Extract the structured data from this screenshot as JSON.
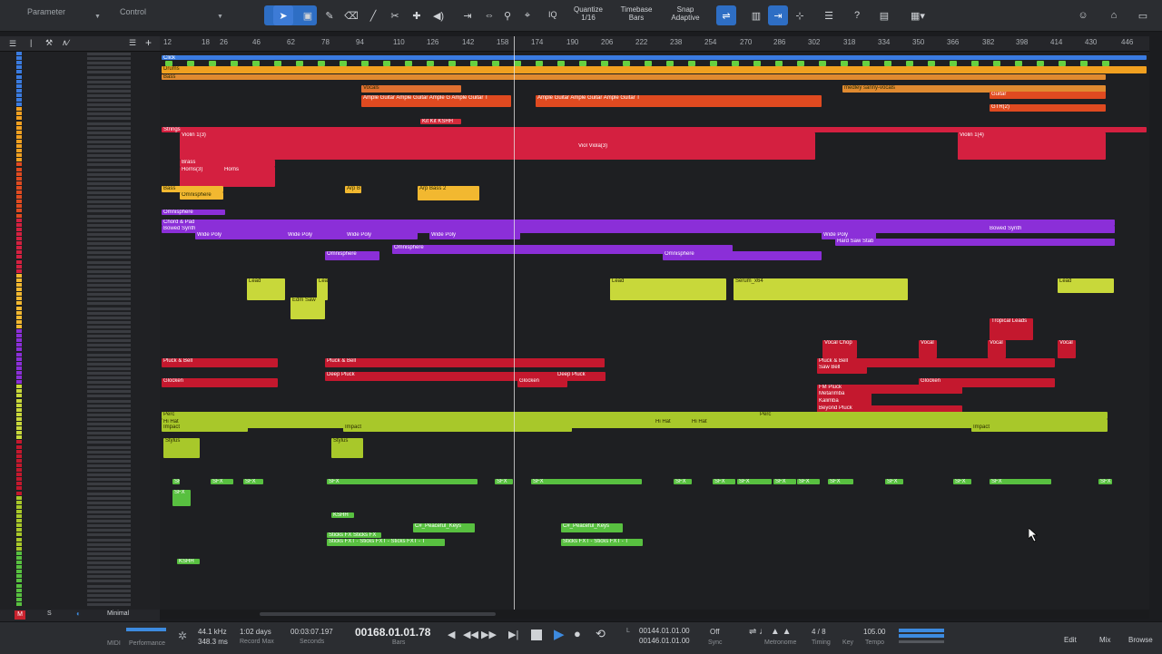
{
  "toolbar": {
    "parameter_label": "Parameter",
    "control_label": "Control",
    "quantize_label": "Quantize",
    "quantize_value": "1/16",
    "timebase_label": "Timebase",
    "timebase_value": "Bars",
    "snap_label": "Snap",
    "snap_value": "Adaptive",
    "iq_label": "IQ"
  },
  "ruler": {
    "ticks": [
      "12",
      "18",
      "26",
      "46",
      "62",
      "78",
      "94",
      "110",
      "126",
      "142",
      "158",
      "174",
      "190",
      "206",
      "222",
      "238",
      "254",
      "270",
      "286",
      "302",
      "318",
      "334",
      "350",
      "366",
      "382",
      "398",
      "414",
      "430",
      "446"
    ]
  },
  "clips": [
    {
      "label": "Click",
      "color": "#3a7be0",
      "light": false
    },
    {
      "label": "Drums",
      "color": "#f0a020",
      "light": true
    },
    {
      "label": "Bass",
      "color": "#e08a30",
      "light": true
    },
    {
      "label": "Vocals",
      "color": "#e07030",
      "light": true
    },
    {
      "label": "medley sanny-vocals",
      "color": "#e08a30",
      "light": true
    },
    {
      "label": "Guitar",
      "color": "#e04a20",
      "light": false
    },
    {
      "label": "Ample Guitar Ample Guitar Ample G Ample Guitar T",
      "color": "#e04a20",
      "light": false
    },
    {
      "label": "Ample Guitar Ample Guitar Ample Guitar T",
      "color": "#e04a20",
      "light": false
    },
    {
      "label": "GTR(2)",
      "color": "#e04a20",
      "light": false
    },
    {
      "label": "Kit Kit KSHH",
      "color": "#d42a3a",
      "light": false
    },
    {
      "label": "Strings",
      "color": "#d42040",
      "light": false
    },
    {
      "label": "Violin 1(3)",
      "color": "#d42040",
      "light": false
    },
    {
      "label": "Viol Viola(3)",
      "color": "#d42040",
      "light": false
    },
    {
      "label": "Violin 1(4)",
      "color": "#d42040",
      "light": false
    },
    {
      "label": "Brass",
      "color": "#d42040",
      "light": false
    },
    {
      "label": "Horns(3)",
      "color": "#d42040",
      "light": false
    },
    {
      "label": "Horns",
      "color": "#d42040",
      "light": false
    },
    {
      "label": "Bass",
      "color": "#f2b830",
      "light": true
    },
    {
      "label": "Omnisphere",
      "color": "#f2b830",
      "light": true
    },
    {
      "label": "Arp B",
      "color": "#f2b830",
      "light": true
    },
    {
      "label": "Arp Bass 2",
      "color": "#f2b830",
      "light": true
    },
    {
      "label": "Chord & Pad",
      "color": "#8b2fd8",
      "light": false
    },
    {
      "label": "Bowed Synth",
      "color": "#8b2fd8",
      "light": false
    },
    {
      "label": "Wide Poly",
      "color": "#8b2fd8",
      "light": false
    },
    {
      "label": "Wide Poly",
      "color": "#8b2fd8",
      "light": false
    },
    {
      "label": "Wide Poly",
      "color": "#8b2fd8",
      "light": false
    },
    {
      "label": "Wide Poly",
      "color": "#8b2fd8",
      "light": false
    },
    {
      "label": "Bowed Synth",
      "color": "#8b2fd8",
      "light": false
    },
    {
      "label": "Wide Poly",
      "color": "#8b2fd8",
      "light": false
    },
    {
      "label": "Hard Saw Stab",
      "color": "#8b2fd8",
      "light": false
    },
    {
      "label": "Omnisphere",
      "color": "#8b2fd8",
      "light": false
    },
    {
      "label": "Omnisphere",
      "color": "#8b2fd8",
      "light": false
    },
    {
      "label": "Omnisphere",
      "color": "#8b2fd8",
      "light": false
    },
    {
      "label": "Omnisphere",
      "color": "#8b2fd8",
      "light": false
    },
    {
      "label": "Lead",
      "color": "#c8d83a",
      "light": true
    },
    {
      "label": "Lead",
      "color": "#c8d83a",
      "light": true
    },
    {
      "label": "Edm Saw",
      "color": "#c8d83a",
      "light": true
    },
    {
      "label": "Lead",
      "color": "#c8d83a",
      "light": true
    },
    {
      "label": "Serum_x64",
      "color": "#c8d83a",
      "light": true
    },
    {
      "label": "Lead",
      "color": "#c8d83a",
      "light": true
    },
    {
      "label": "Tropical Leads",
      "color": "#c4182e",
      "light": false
    },
    {
      "label": "Vocal Chop",
      "color": "#c4182e",
      "light": false
    },
    {
      "label": "Vocal",
      "color": "#c4182e",
      "light": false
    },
    {
      "label": "Vocal",
      "color": "#c4182e",
      "light": false
    },
    {
      "label": "Vocal",
      "color": "#c4182e",
      "light": false
    },
    {
      "label": "Pluck & Bell",
      "color": "#c4182e",
      "light": false
    },
    {
      "label": "Pluck & Bell",
      "color": "#c4182e",
      "light": false
    },
    {
      "label": "Deep Pluck",
      "color": "#c4182e",
      "light": false
    },
    {
      "label": "Deep Pluck",
      "color": "#c4182e",
      "light": false
    },
    {
      "label": "Pluck & Bell",
      "color": "#c4182e",
      "light": false
    },
    {
      "label": "Saw Bell",
      "color": "#c4182e",
      "light": false
    },
    {
      "label": "Glocken",
      "color": "#c4182e",
      "light": false
    },
    {
      "label": "Glocken",
      "color": "#c4182e",
      "light": false
    },
    {
      "label": "Glocken",
      "color": "#c4182e",
      "light": false
    },
    {
      "label": "Serum_x64",
      "color": "#c4182e",
      "light": false
    },
    {
      "label": "FM Pluck",
      "color": "#c4182e",
      "light": false
    },
    {
      "label": "Metarimba",
      "color": "#c4182e",
      "light": false
    },
    {
      "label": "Kalimba",
      "color": "#c4182e",
      "light": false
    },
    {
      "label": "Beyond Pluck",
      "color": "#c4182e",
      "light": false
    },
    {
      "label": "Perc",
      "color": "#a8c82a",
      "light": true
    },
    {
      "label": "Hi Hat",
      "color": "#a8c82a",
      "light": true
    },
    {
      "label": "Impact",
      "color": "#a8c82a",
      "light": true
    },
    {
      "label": "Hi Hat",
      "color": "#a8c82a",
      "light": true
    },
    {
      "label": "Hi Hat",
      "color": "#a8c82a",
      "light": true
    },
    {
      "label": "Perc",
      "color": "#a8c82a",
      "light": true
    },
    {
      "label": "Impact",
      "color": "#a8c82a",
      "light": true
    },
    {
      "label": "Impact",
      "color": "#a8c82a",
      "light": true
    },
    {
      "label": "Stylus",
      "color": "#a8c82a",
      "light": true
    },
    {
      "label": "Stylus",
      "color": "#a8c82a",
      "light": true
    },
    {
      "label": "SFX",
      "color": "#58c040",
      "light": false
    },
    {
      "label": "SFX",
      "color": "#58c040",
      "light": false
    },
    {
      "label": "SFX",
      "color": "#58c040",
      "light": false
    },
    {
      "label": "SFX",
      "color": "#58c040",
      "light": false
    },
    {
      "label": "SFX",
      "color": "#58c040",
      "light": false
    },
    {
      "label": "SFX",
      "color": "#58c040",
      "light": false
    },
    {
      "label": "SFX",
      "color": "#58c040",
      "light": false
    },
    {
      "label": "SFX",
      "color": "#58c040",
      "light": false
    },
    {
      "label": "SFX",
      "color": "#58c040",
      "light": false
    },
    {
      "label": "SFX",
      "color": "#58c040",
      "light": false
    },
    {
      "label": "SFX",
      "color": "#58c040",
      "light": false
    },
    {
      "label": "SFX",
      "color": "#58c040",
      "light": false
    },
    {
      "label": "SFX",
      "color": "#58c040",
      "light": false
    },
    {
      "label": "SFX",
      "color": "#58c040",
      "light": false
    },
    {
      "label": "SFX",
      "color": "#58c040",
      "light": false
    },
    {
      "label": "SFX",
      "color": "#58c040",
      "light": false
    },
    {
      "label": "SFX",
      "color": "#58c040",
      "light": false
    },
    {
      "label": "Sticks FX Sticks FX",
      "color": "#58c040",
      "light": false
    },
    {
      "label": "Sticks FXT - Sticks FXT - Sticks FXT - T",
      "color": "#58c040",
      "light": false
    },
    {
      "label": "Sticks FXT - Sticks FXT - T",
      "color": "#58c040",
      "light": false
    },
    {
      "label": "C#_Peaceful_Keys",
      "color": "#58c040",
      "light": false
    },
    {
      "label": "C#_Peaceful_Keys",
      "color": "#58c040",
      "light": false
    },
    {
      "label": "KSHH",
      "color": "#58c040",
      "light": false
    },
    {
      "label": "KSHH",
      "color": "#58c040",
      "light": false
    }
  ],
  "transport": {
    "sample_rate": "44.1 kHz",
    "latency": "348.3 ms",
    "record_time": "1:02 days",
    "record_time_label": "Record Max",
    "seconds_value": "00:03:07.197",
    "seconds_label": "Seconds",
    "bars_value": "00168.01.01.78",
    "bars_label": "Bars",
    "loop_start": "00144.01.01.00",
    "loop_end": "00146.01.01.00",
    "sync_label": "Sync",
    "sync_value": "Off",
    "metronome_label": "Metronome",
    "timing_label": "Timing",
    "timing_value": "4 / 8",
    "key_label": "Key",
    "tempo_label": "Tempo",
    "tempo_value": "105.00",
    "midi_label": "MIDI",
    "performance_label": "Performance",
    "minimal_label": "Minimal",
    "edit_label": "Edit",
    "mix_label": "Mix",
    "browse_label": "Browse"
  }
}
